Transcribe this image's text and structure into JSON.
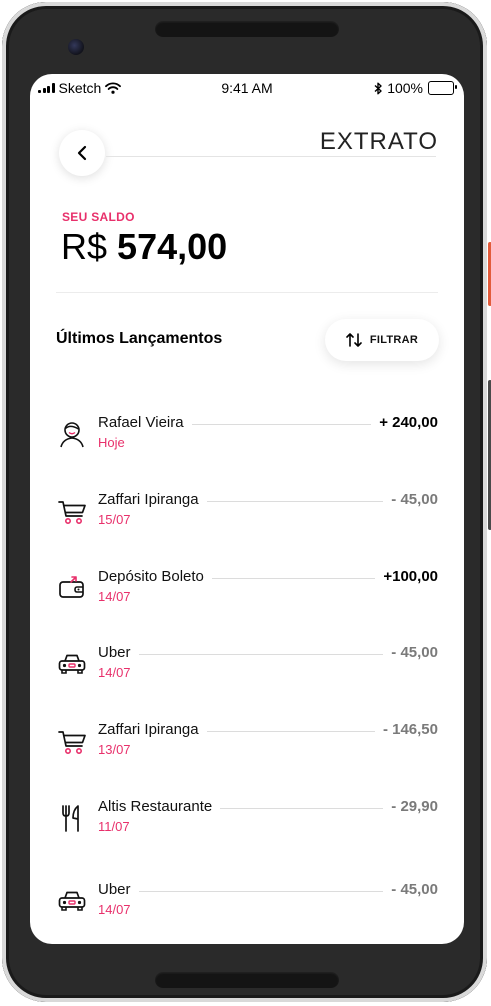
{
  "status_bar": {
    "carrier": "Sketch",
    "time": "9:41 AM",
    "battery": "100%"
  },
  "header": {
    "title": "EXTRATO"
  },
  "balance": {
    "label": "SEU SALDO",
    "currency": "R$",
    "amount": "574,00"
  },
  "section": {
    "title": "Últimos Lançamentos",
    "filter_label": "FILTRAR"
  },
  "transactions": [
    {
      "name": "Rafael Vieira",
      "date": "Hoje",
      "amount": "+ 240,00",
      "icon": "person-icon"
    },
    {
      "name": "Zaffari Ipiranga",
      "date": "15/07",
      "amount": "- 45,00",
      "icon": "shopping-cart-icon"
    },
    {
      "name": "Depósito Boleto",
      "date": "14/07",
      "amount": "+100,00",
      "icon": "wallet-icon"
    },
    {
      "name": "Uber",
      "date": "14/07",
      "amount": "- 45,00",
      "icon": "car-icon"
    },
    {
      "name": "Zaffari Ipiranga",
      "date": "13/07",
      "amount": "- 146,50",
      "icon": "shopping-cart-icon"
    },
    {
      "name": "Altis Restaurante",
      "date": "11/07",
      "amount": "- 29,90",
      "icon": "fork-knife-icon"
    },
    {
      "name": "Uber",
      "date": "14/07",
      "amount": "- 45,00",
      "icon": "car-icon"
    }
  ],
  "colors": {
    "accent": "#e8306b",
    "text": "#111111",
    "muted": "#7a7a7a"
  }
}
